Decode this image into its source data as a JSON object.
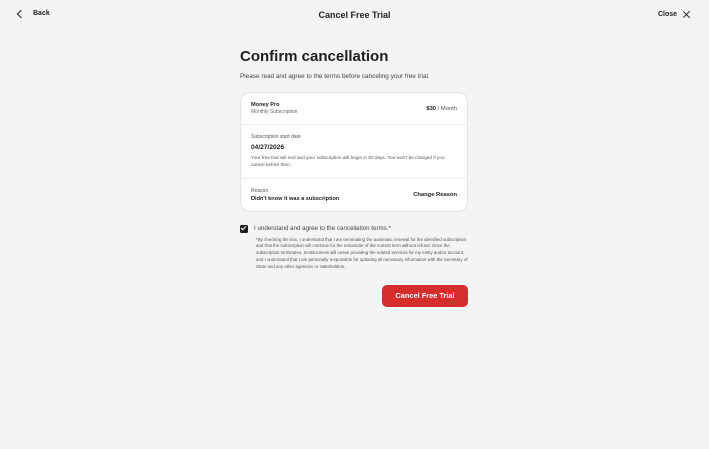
{
  "header": {
    "back_label": "Back",
    "title": "Cancel Free Trial",
    "close_label": "Close"
  },
  "main": {
    "heading": "Confirm cancellation",
    "subheading": "Please read and agree to the terms before canceling your free trial."
  },
  "card": {
    "plan_name": "Money Pro",
    "plan_type": "Monthly Subscription",
    "price": "$30",
    "price_period": "/ Month",
    "start_label": "Subscription start date",
    "start_date": "04/27/2026",
    "start_note": "Your free trial will end and your subscription will begin in 60 days. You won't be charged if you cancel before then.",
    "reason_label": "Reason",
    "reason_value": "Didn't know it was a subscription",
    "change_reason_label": "Change Reason"
  },
  "agreement": {
    "checked": true,
    "label": "I understand and agree to the cancellation terms.*",
    "disclaimer": "*By checking the box, I understand that I am terminating the automatic renewal for the identified subscription and that the subscription will continue for the remainder of the current term without refund. Once the subscription terminates, ZenBusiness will cease providing the related services for my entity and/or account, and I understand that I am personally responsible for updating all necessary information with the Secretary of State and any other agencies or stakeholders."
  },
  "actions": {
    "cancel_button_label": "Cancel Free Trial"
  },
  "colors": {
    "accent": "#d52c2c",
    "background": "#f4f4f4"
  }
}
